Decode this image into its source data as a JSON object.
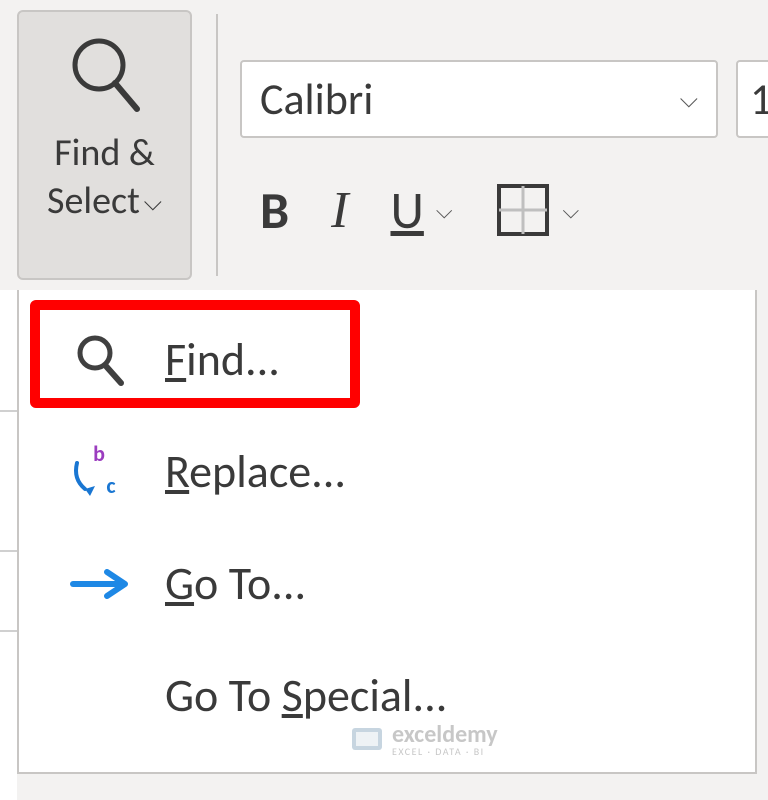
{
  "ribbon": {
    "find_select_label_line1": "Find &",
    "find_select_label_line2": "Select",
    "font_name": "Calibri",
    "size_partial": "1",
    "bold": "B",
    "italic": "I",
    "underline": "U"
  },
  "menu": {
    "find": "ind...",
    "find_accel": "F",
    "replace": "eplace...",
    "replace_accel": "R",
    "goto": "o To...",
    "goto_accel": "G",
    "goto_special_pre": "Go To ",
    "goto_special_accel": "S",
    "goto_special_post": "pecial..."
  },
  "watermark": {
    "brand": "exceldemy",
    "tagline": "EXCEL · DATA · BI"
  }
}
